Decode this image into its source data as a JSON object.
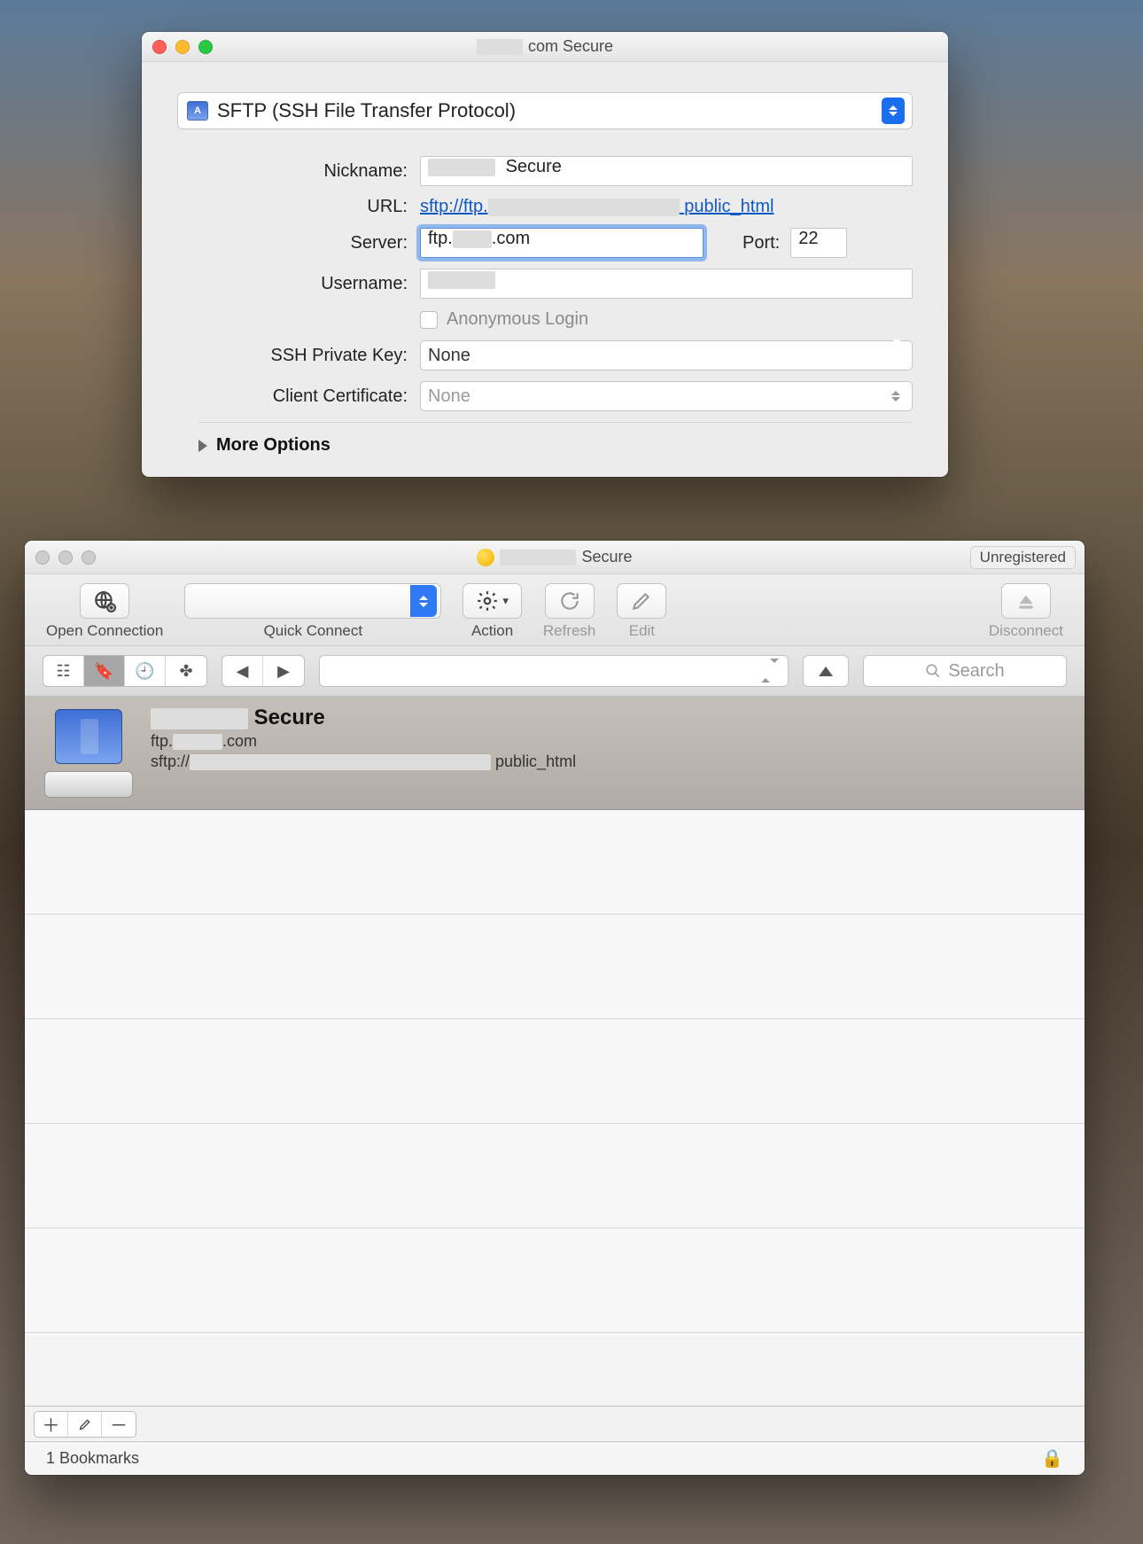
{
  "settings": {
    "window_title_suffix": "com Secure",
    "protocol": "SFTP (SSH File Transfer Protocol)",
    "labels": {
      "nickname": "Nickname:",
      "url": "URL:",
      "server": "Server:",
      "port": "Port:",
      "username": "Username:",
      "anonymous": "Anonymous Login",
      "ssh_key": "SSH Private Key:",
      "client_cert": "Client Certificate:",
      "more": "More Options"
    },
    "values": {
      "nickname_suffix": "Secure",
      "url_prefix": "sftp://ftp.",
      "url_suffix": "public_html",
      "server_prefix": "ftp.",
      "server_suffix": ".com",
      "port": "22",
      "ssh_key": "None",
      "client_cert": "None"
    }
  },
  "browser": {
    "window_title_suffix": "Secure",
    "unregistered": "Unregistered",
    "toolbar": {
      "open_connection": "Open Connection",
      "quick_connect": "Quick Connect",
      "action": "Action",
      "refresh": "Refresh",
      "edit": "Edit",
      "disconnect": "Disconnect"
    },
    "search_placeholder": "Search",
    "bookmark": {
      "title_suffix": "Secure",
      "host_prefix": "ftp.",
      "host_suffix": ".com",
      "url_prefix": "sftp://",
      "url_suffix": "public_html"
    },
    "status": "1 Bookmarks"
  }
}
